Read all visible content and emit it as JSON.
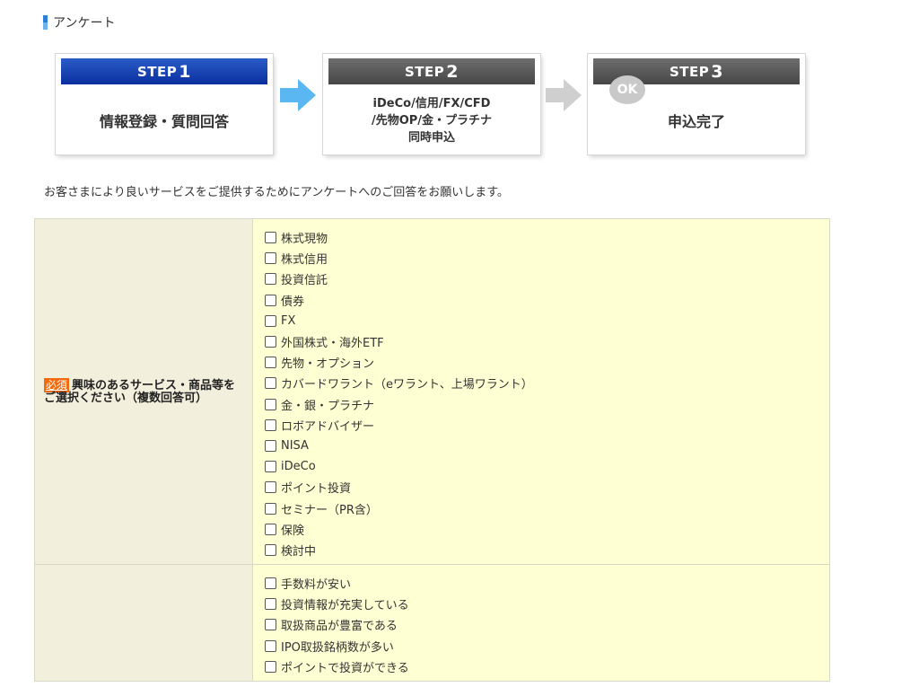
{
  "section": {
    "title": "アンケート"
  },
  "steps": [
    {
      "label": "STEP",
      "num": "1",
      "text": "情報登録・質問回答",
      "active": true
    },
    {
      "label": "STEP",
      "num": "2",
      "text_lines": [
        "iDeCo/信用/FX/CFD",
        "/先物OP/金・プラチナ",
        "同時申込"
      ],
      "active": false
    },
    {
      "label": "STEP",
      "num": "3",
      "text": "申込完了",
      "badge": "OK",
      "active": false
    }
  ],
  "intro": "お客さまにより良いサービスをご提供するためにアンケートへのご回答をお願いします。",
  "questions": [
    {
      "required_label": "必須",
      "text": "興味のあるサービス・商品等をご選択ください（複数回答可）",
      "options": [
        "株式現物",
        "株式信用",
        "投資信託",
        "債券",
        "FX",
        "外国株式・海外ETF",
        "先物・オプション",
        "カバードワラント（eワラント、上場ワラント）",
        "金・銀・プラチナ",
        "ロボアドバイザー",
        "NISA",
        "iDeCo",
        "ポイント投資",
        "セミナー（PR含）",
        "保険",
        "検討中"
      ]
    },
    {
      "options": [
        "手数料が安い",
        "投資情報が充実している",
        "取扱商品が豊富である",
        "IPO取扱銘柄数が多い",
        "ポイントで投資ができる"
      ]
    }
  ],
  "colors": {
    "accent_blue": "#0a2f9e",
    "required_orange": "#f26a0c",
    "answer_bg": "#ffffd4",
    "question_bg": "#f2efdd"
  }
}
